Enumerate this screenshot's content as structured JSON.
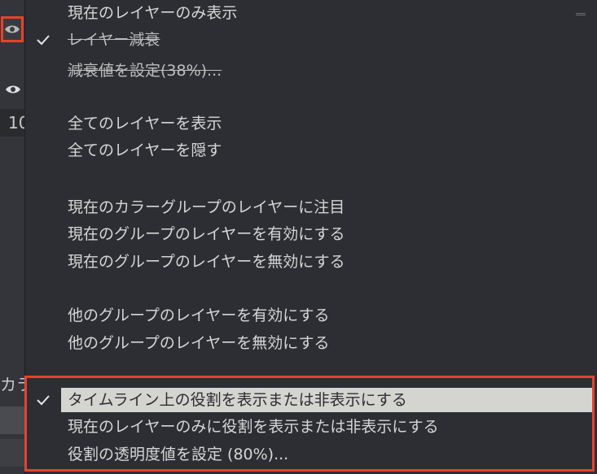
{
  "left_panel": {
    "fragment_number": "10",
    "fragment_text": "カラ"
  },
  "menu": {
    "items": [
      {
        "label": "現在のレイヤーのみ表示",
        "checked": false
      },
      {
        "label": "レイヤー減衰",
        "checked": true
      },
      {
        "label": "減衰値を設定(38%)...",
        "checked": false
      },
      {
        "label": "全てのレイヤーを表示",
        "checked": false
      },
      {
        "label": "全てのレイヤーを隠す",
        "checked": false
      },
      {
        "label": "現在のカラーグループのレイヤーに注目",
        "checked": false
      },
      {
        "label": "現在のグループのレイヤーを有効にする",
        "checked": false
      },
      {
        "label": "現在のグループのレイヤーを無効にする",
        "checked": false
      },
      {
        "label": "他のグループのレイヤーを有効にする",
        "checked": false
      },
      {
        "label": "他のグループのレイヤーを無効にする",
        "checked": false
      },
      {
        "label": "タイムライン上の役割を表示または非表示にする",
        "checked": true
      },
      {
        "label": "現在のレイヤーのみに役割を表示または非表示にする",
        "checked": false
      },
      {
        "label": "役割の透明度値を設定 (80%)...",
        "checked": false
      }
    ]
  },
  "colors": {
    "menu_bg": "#2d2e33",
    "text": "#d6d6d6",
    "highlight_bg": "#d4d4d0",
    "annotation_red": "#e5432c"
  }
}
